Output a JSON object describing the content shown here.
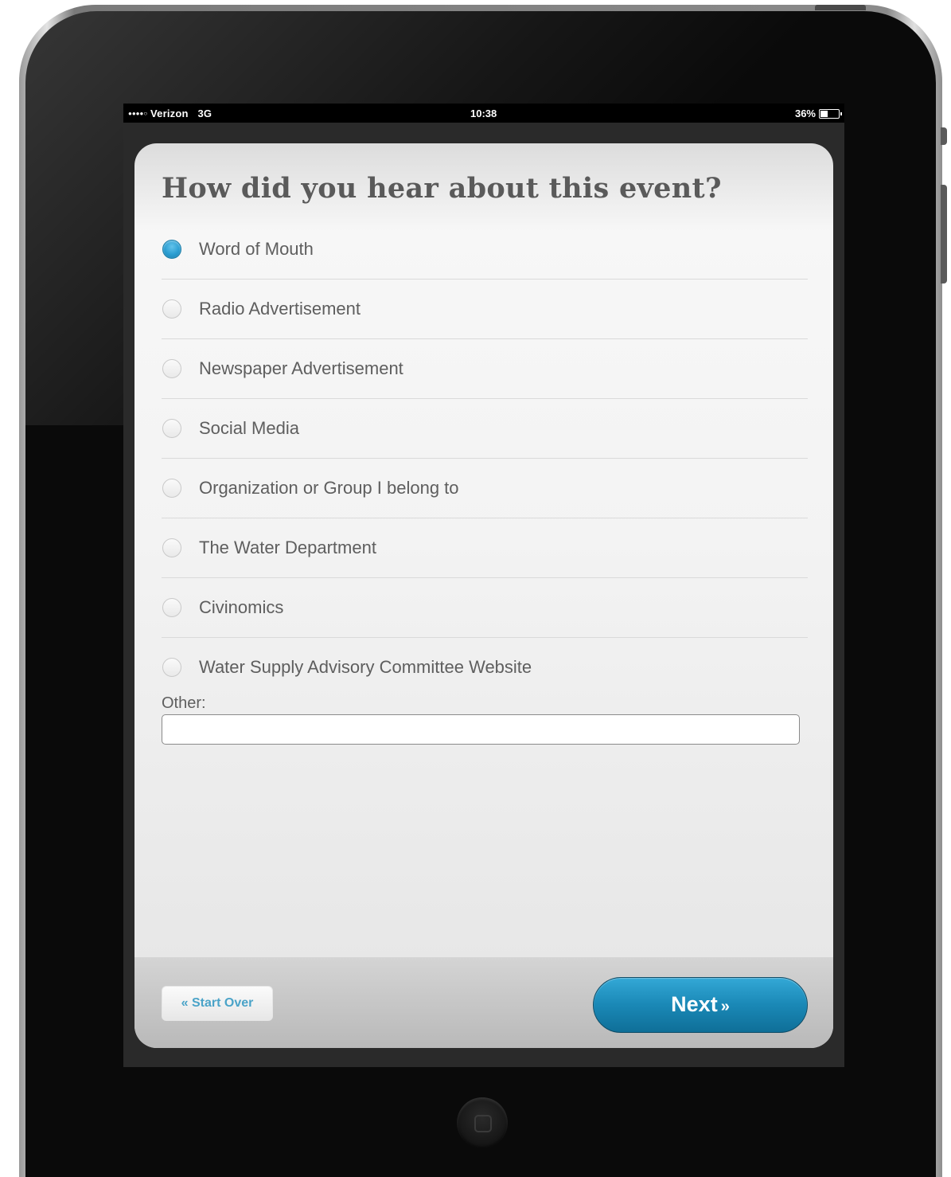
{
  "status_bar": {
    "carrier": "Verizon",
    "network": "3G",
    "time": "10:38",
    "battery": "36%",
    "battery_level": 0.36
  },
  "survey": {
    "question": "How did you hear about this event?",
    "options": [
      {
        "label": "Word of Mouth",
        "selected": true
      },
      {
        "label": "Radio Advertisement",
        "selected": false
      },
      {
        "label": "Newspaper Advertisement",
        "selected": false
      },
      {
        "label": "Social Media",
        "selected": false
      },
      {
        "label": "Organization or Group I belong to",
        "selected": false
      },
      {
        "label": "The Water Department",
        "selected": false
      },
      {
        "label": "Civinomics",
        "selected": false
      },
      {
        "label": "Water Supply Advisory Committee Website",
        "selected": false
      }
    ],
    "other_label": "Other:",
    "other_value": ""
  },
  "footer": {
    "start_over_label": "« Start Over",
    "next_label": "Next",
    "next_arrow": "»"
  },
  "colors": {
    "accent": "#1a88b6",
    "link": "#4aa3c8",
    "bezel": "#0a0a0a"
  }
}
